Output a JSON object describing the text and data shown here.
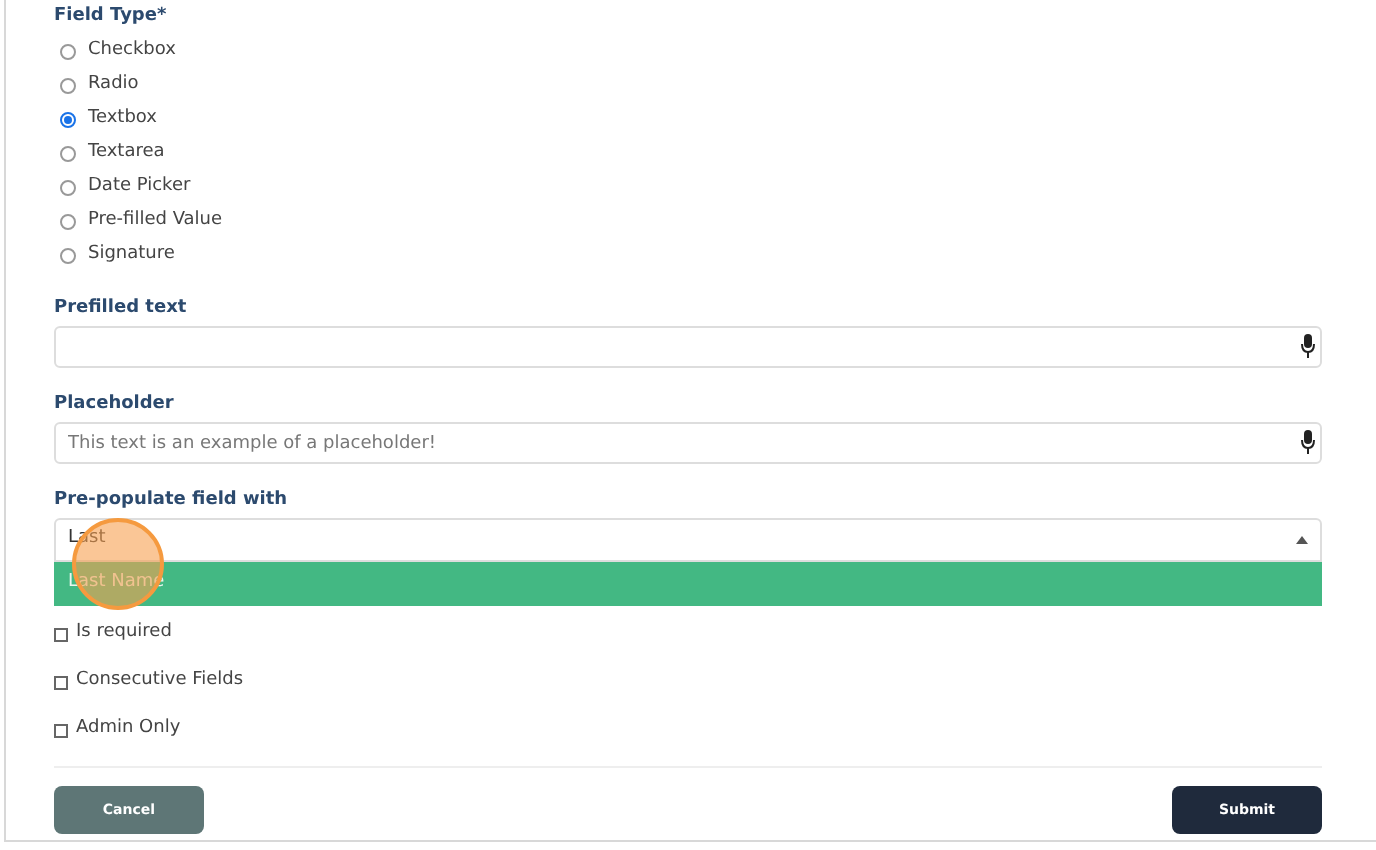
{
  "field_type": {
    "label": "Field Type*",
    "options": [
      {
        "label": "Checkbox",
        "selected": false
      },
      {
        "label": "Radio",
        "selected": false
      },
      {
        "label": "Textbox",
        "selected": true
      },
      {
        "label": "Textarea",
        "selected": false
      },
      {
        "label": "Date Picker",
        "selected": false
      },
      {
        "label": "Pre-filled Value",
        "selected": false
      },
      {
        "label": "Signature",
        "selected": false
      }
    ]
  },
  "prefilled_text": {
    "label": "Prefilled text"
  },
  "placeholder_field": {
    "label": "Placeholder",
    "placeholder": "This text is an example of a placeholder!"
  },
  "prepopulate": {
    "label": "Pre-populate field with",
    "value": "Last",
    "expanded": true,
    "options": [
      {
        "label": "Last Name",
        "selected": true
      }
    ]
  },
  "click_indicator": true,
  "checkboxes": [
    {
      "label": "Is required",
      "checked": false
    },
    {
      "label": "Consecutive Fields",
      "checked": false
    },
    {
      "label": "Admin Only",
      "checked": false
    }
  ],
  "buttons": [
    {
      "label": "Cancel",
      "kind": "secondary"
    },
    {
      "label": "Submit",
      "kind": "primary"
    }
  ]
}
